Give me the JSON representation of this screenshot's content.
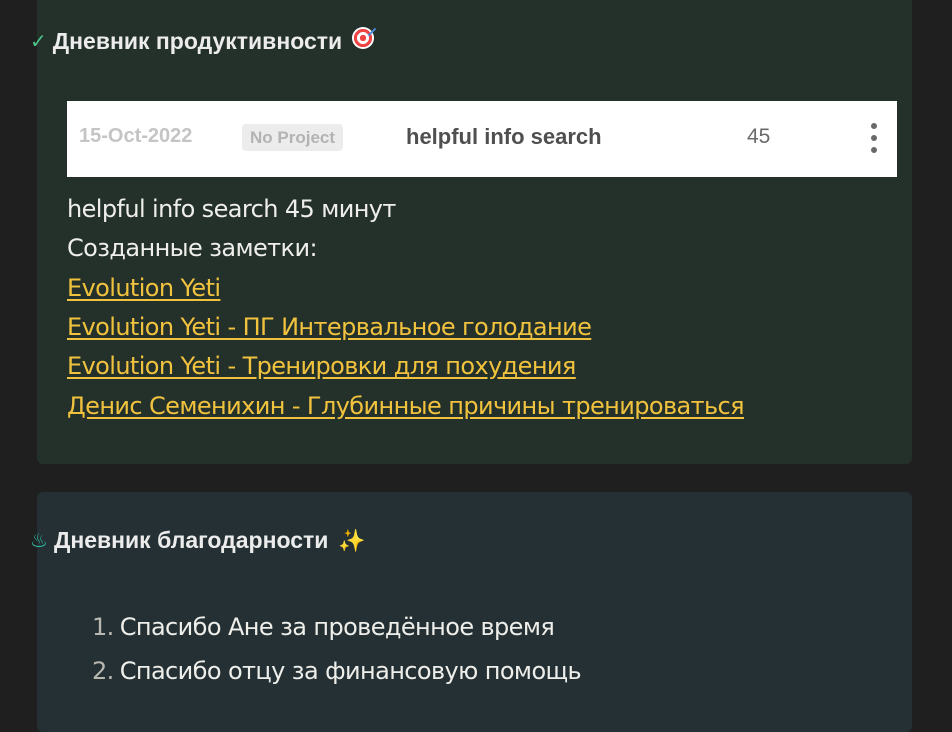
{
  "productivity": {
    "title": "Дневник продуктивности",
    "task": {
      "date": "15-Oct-2022",
      "project": "No Project",
      "name": "helpful info search",
      "duration": "45"
    },
    "summary": "helpful info search 45 минут",
    "notes_label": "Созданные заметки:",
    "notes": [
      "Evolution Yeti",
      "Evolution Yeti - ПГ Интервальное голодание",
      "Evolution Yeti - Тренировки для похудения",
      "Денис Семенихин - Глубинные причины тренироваться"
    ]
  },
  "gratitude": {
    "title": "Дневник благодарности",
    "items": [
      {
        "num": "1.",
        "text": "Спасибо Ане за проведённое время"
      },
      {
        "num": "2.",
        "text": "Спасибо отцу за финансовую помощь"
      }
    ]
  },
  "icons": {
    "productivity_prefix": "check-icon",
    "productivity_emoji": "target-icon",
    "gratitude_prefix": "flame-icon",
    "gratitude_emoji": "sparkle-icon"
  },
  "colors": {
    "link": "#f0c23e",
    "card_productivity": "#24302a",
    "card_gratitude": "#243033",
    "background": "#1f1f1f"
  }
}
